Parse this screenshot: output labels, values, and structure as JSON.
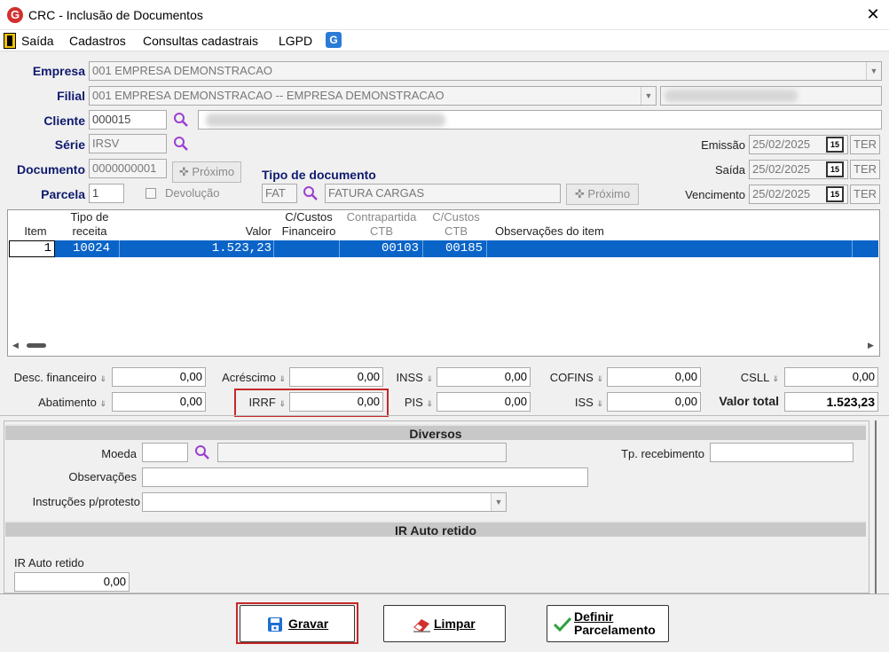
{
  "window": {
    "title": "CRC - Inclusão de Documentos",
    "close_glyph": "✕",
    "logo_letter": "G"
  },
  "menu": {
    "items": [
      "Saída",
      "Cadastros",
      "Consultas cadastrais",
      "LGPD"
    ]
  },
  "form": {
    "empresa_label": "Empresa",
    "empresa_value": "001 EMPRESA DEMONSTRACAO",
    "filial_label": "Filial",
    "filial_value": "001 EMPRESA DEMONSTRACAO -- EMPRESA DEMONSTRACAO",
    "cliente_label": "Cliente",
    "cliente_value": "000015",
    "serie_label": "Série",
    "serie_value": "IRSV",
    "documento_label": "Documento",
    "documento_value": "0000000001",
    "proximo_label": "Próximo",
    "parcela_label": "Parcela",
    "parcela_value": "1",
    "devolucao_label": "Devolução",
    "tipo_doc_label": "Tipo de documento",
    "tipo_doc_code": "FAT",
    "tipo_doc_desc": "FATURA CARGAS",
    "proximo2_label": "Próximo",
    "emissao_label": "Emissão",
    "emissao_value": "25/02/2025",
    "saida_label": "Saída",
    "saida_value": "25/02/2025",
    "vencimento_label": "Vencimento",
    "vencimento_value": "25/02/2025",
    "ter_label": "TER",
    "cal_glyph": "15"
  },
  "grid": {
    "headers": {
      "item": "Item",
      "tipo1": "Tipo de",
      "tipo2": "receita",
      "valor": "Valor",
      "cc1": "C/Custos",
      "cc2": "Financeiro",
      "contra1": "Contrapartida",
      "contra2": "CTB",
      "cctb1": "C/Custos",
      "cctb2": "CTB",
      "obs": "Observações do item"
    },
    "row": {
      "item": "1",
      "tipo": "10024",
      "valor": "1.523,23",
      "contra": "00103",
      "cctb": "00185"
    }
  },
  "totals": {
    "desc_fin_label": "Desc. financeiro",
    "desc_fin_value": "0,00",
    "acrescimo_label": "Acréscimo",
    "acrescimo_value": "0,00",
    "inss_label": "INSS",
    "inss_value": "0,00",
    "cofins_label": "COFINS",
    "cofins_value": "0,00",
    "csll_label": "CSLL",
    "csll_value": "0,00",
    "abatimento_label": "Abatimento",
    "abatimento_value": "0,00",
    "irrf_label": "IRRF",
    "irrf_value": "0,00",
    "pis_label": "PIS",
    "pis_value": "0,00",
    "iss_label": "ISS",
    "iss_value": "0,00",
    "valor_total_label": "Valor total",
    "valor_total_value": "1.523,23"
  },
  "diversos": {
    "title": "Diversos",
    "moeda_label": "Moeda",
    "tp_receb_label": "Tp. recebimento",
    "obs_label": "Observações",
    "instrucoes_label": "Instruções p/protesto"
  },
  "ir_auto": {
    "title": "IR Auto retido",
    "label": "IR Auto retido",
    "value": "0,00"
  },
  "buttons": {
    "gravar": "Gravar",
    "limpar": "Limpar",
    "definir1": "Definir",
    "definir2": "Parcelamento"
  },
  "colors": {
    "selection": "#0a64c8",
    "label_blue": "#0f1a6e",
    "highlight_red": "#c62828"
  }
}
